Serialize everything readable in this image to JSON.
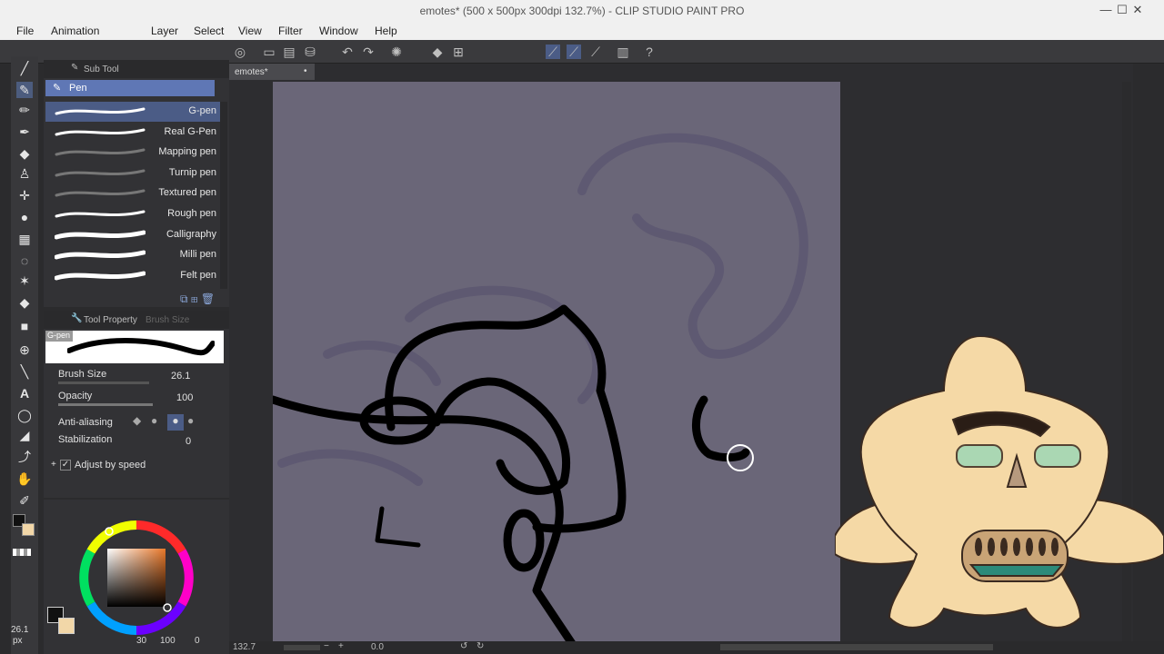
{
  "window": {
    "title": "emotes* (500 x 500px 300dpi 132.7%) - CLIP STUDIO PAINT PRO",
    "minimize": "—",
    "maximize": "☐",
    "close": "✕"
  },
  "menu": [
    "File",
    "Animation",
    "Layer",
    "Select",
    "View",
    "Filter",
    "Window",
    "Help"
  ],
  "panels": {
    "subtool_title": "Sub Tool",
    "group_label": "Pen",
    "brushes": [
      {
        "name": "G-pen",
        "selected": true
      },
      {
        "name": "Real G-Pen",
        "selected": false
      },
      {
        "name": "Mapping pen",
        "selected": false
      },
      {
        "name": "Turnip pen",
        "selected": false
      },
      {
        "name": "Textured pen",
        "selected": false
      },
      {
        "name": "Rough pen",
        "selected": false
      },
      {
        "name": "Calligraphy",
        "selected": false
      },
      {
        "name": "Milli pen",
        "selected": false
      },
      {
        "name": "Felt pen",
        "selected": false
      }
    ],
    "toolprop_title": "Tool Property",
    "toolprop_tab2": "Brush Size",
    "preview_label": "G-pen",
    "brush_size_label": "Brush Size",
    "brush_size_value": "26.1",
    "opacity_label": "Opacity",
    "opacity_value": "100",
    "antialiasing_label": "Anti-aliasing",
    "stabilization_label": "Stabilization",
    "stabilization_value": "0",
    "adjust_speed_label": "Adjust by speed",
    "adjust_speed_checked": true
  },
  "document": {
    "tab_label": "emotes*"
  },
  "left_bottom": {
    "size_value": "26.1",
    "size_unit": "px"
  },
  "colorpanel": {
    "value_a": "30",
    "value_b": "100",
    "value_c": "0",
    "main_color": "#111111",
    "sub_color": "#f2d7a8"
  },
  "statusbar": {
    "zoom": "132.7",
    "rotation": "0.0"
  },
  "colors": {
    "accent": "#4b5c86",
    "paper": "#6a6678"
  }
}
